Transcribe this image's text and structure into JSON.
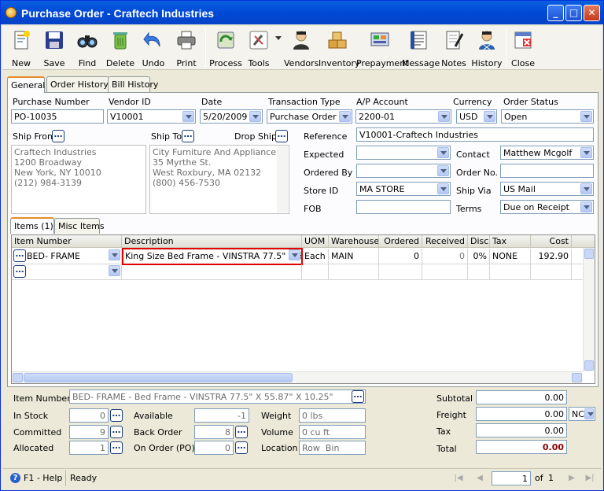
{
  "window": {
    "title": "Purchase Order - Craftech Industries"
  },
  "toolbar": [
    "New",
    "Save",
    "Find",
    "Delete",
    "Undo",
    "Print",
    "Process",
    "Tools",
    "Vendors",
    "Inventory",
    "Prepayment",
    "Message",
    "Notes",
    "History",
    "Close"
  ],
  "tabs": {
    "general": "General",
    "history": "Order History",
    "bill": "Bill History"
  },
  "header": {
    "purchase_number_label": "Purchase Number",
    "purchase_number": "PO-10035",
    "vendor_id_label": "Vendor ID",
    "vendor_id": "V10001",
    "date_label": "Date",
    "date": "5/20/2009",
    "transaction_type_label": "Transaction Type",
    "transaction_type": "Purchase Order",
    "ap_account_label": "A/P Account",
    "ap_account": "2200-01",
    "currency_label": "Currency",
    "currency": "USD",
    "order_status_label": "Order Status",
    "order_status": "Open"
  },
  "ship_from": {
    "label": "Ship From",
    "lines": "Craftech Industries\n1200 Broadway\nNew York, NY 10010\n(212) 984-3139"
  },
  "ship_to": {
    "label": "Ship To",
    "lines": "City Furniture And Appliance\n35 Myrthe St.\nWest Roxbury, MA 02132\n(800) 456-7530"
  },
  "drop_ship": {
    "label": "Drop Ship"
  },
  "details": {
    "reference_label": "Reference",
    "reference": "V10001-Craftech Industries",
    "expected_label": "Expected",
    "expected": "",
    "contact_label": "Contact",
    "contact": "Matthew Mcgolf",
    "ordered_by_label": "Ordered By",
    "ordered_by": "",
    "order_no_label": "Order No.",
    "order_no": "",
    "store_id_label": "Store ID",
    "store_id": "MA STORE",
    "ship_via_label": "Ship Via",
    "ship_via": "US Mail",
    "fob_label": "FOB",
    "fob": "",
    "terms_label": "Terms",
    "terms": "Due on Receipt"
  },
  "subtabs": {
    "items": "Items (1)",
    "misc": "Misc Items"
  },
  "grid": {
    "columns": [
      "Item Number",
      "Description",
      "UOM",
      "Warehouse",
      "Ordered",
      "Received",
      "Disc",
      "Tax",
      "Cost"
    ],
    "rows": [
      {
        "item": "BED- FRAME",
        "description": "King Size Bed Frame - VINSTRA 77.5\" X 55.",
        "uom": "Each",
        "warehouse": "MAIN",
        "ordered": "0",
        "received": "0",
        "disc": "0%",
        "tax": "NONE",
        "cost": "192.90"
      }
    ]
  },
  "footer": {
    "item_number_label": "Item Number",
    "item_number": "BED- FRAME - Bed Frame - VINSTRA 77.5\" X 55.87\" X 10.25\"",
    "in_stock_label": "In Stock",
    "in_stock": "0",
    "committed_label": "Committed",
    "committed": "9",
    "allocated_label": "Allocated",
    "allocated": "1",
    "available_label": "Available",
    "available": "-1",
    "back_order_label": "Back Order",
    "back_order": "8",
    "on_order_label": "On Order (PO)",
    "on_order": "0",
    "weight_label": "Weight",
    "weight": "0 lbs",
    "volume_label": "Volume",
    "volume": "0 cu ft",
    "location_label": "Location",
    "location": "Row  Bin",
    "subtotal_label": "Subtotal",
    "subtotal": "0.00",
    "freight_label": "Freight",
    "freight": "0.00",
    "freight_code": "NC",
    "tax_label": "Tax",
    "tax": "0.00",
    "total_label": "Total",
    "total": "0.00"
  },
  "status": {
    "help": "F1 - Help",
    "state": "Ready",
    "page": "1",
    "of_label": "of",
    "pages": "1"
  },
  "colors": {
    "title_bar": "#0054e3",
    "total": "#8b0000",
    "highlight_border": "#e00000"
  }
}
